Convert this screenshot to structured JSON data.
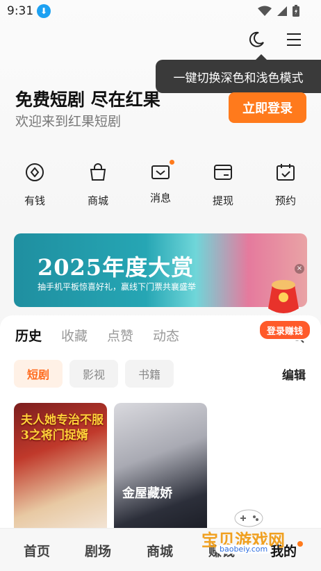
{
  "status_bar": {
    "time": "9:31",
    "download_glyph": "⬇"
  },
  "tooltip": {
    "text": "一键切换深色和浅色模式"
  },
  "header": {
    "headline": "免费短剧 尽在红果",
    "subline": "欢迎来到红果短剧",
    "login_label": "立即登录"
  },
  "quick_menu": [
    {
      "label": "有钱"
    },
    {
      "label": "商城"
    },
    {
      "label": "消息"
    },
    {
      "label": "提现"
    },
    {
      "label": "预约"
    }
  ],
  "banner": {
    "title": "2025年度大赏",
    "subtitle": "抽手机平板惊喜好礼，赢线下门票共襄盛举",
    "close_glyph": "×"
  },
  "earn_badge": {
    "label": "登录赚钱"
  },
  "content": {
    "tabs": [
      "历史",
      "收藏",
      "点赞",
      "动态"
    ],
    "chips": [
      "短剧",
      "影视",
      "书籍"
    ],
    "edit_label": "编辑",
    "cards": [
      {
        "title": "夫人她专治不服3之将门捉婿"
      },
      {
        "title": "金屋藏娇"
      }
    ]
  },
  "bottom_nav": [
    "首页",
    "剧场",
    "商城",
    "赚钱",
    "我的"
  ],
  "watermark": {
    "text": "宝贝游戏网",
    "url": "baobeiy.com"
  },
  "colors": {
    "accent": "#ff7a1c",
    "tooltip_bg": "#3a3a3a",
    "earn": "#ff5a2a"
  }
}
